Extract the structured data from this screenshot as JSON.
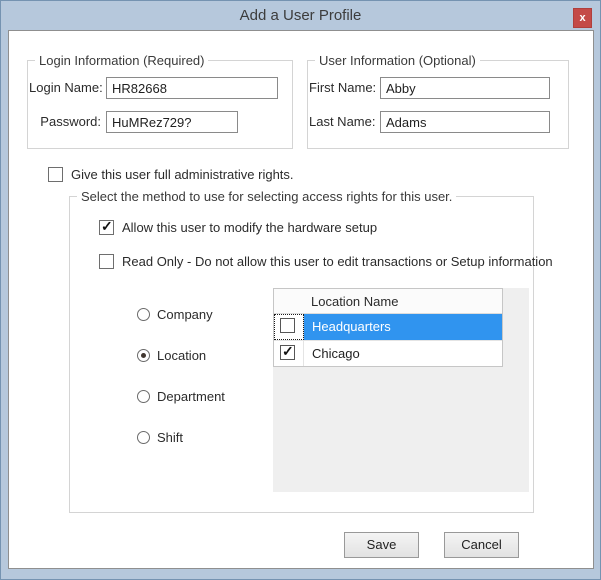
{
  "window": {
    "title": "Add a User Profile",
    "close_label": "x"
  },
  "icons": {
    "checkmark": "✓"
  },
  "colors": {
    "titlebar": "#b6c8dc",
    "close_button": "#c44a47",
    "selection_blue": "#3094ef"
  },
  "login_group": {
    "legend": "Login Information (Required)",
    "login_name": {
      "label": "Login Name:",
      "value": "HR82668"
    },
    "password": {
      "label": "Password:",
      "value": "HuMRez729?"
    }
  },
  "user_group": {
    "legend": "User Information (Optional)",
    "first_name": {
      "label": "First Name:",
      "value": "Abby"
    },
    "last_name": {
      "label": "Last Name:",
      "value": "Adams"
    }
  },
  "admin_checkbox": {
    "label": "Give this user full administrative rights.",
    "checked": false
  },
  "access_group": {
    "legend": "Select the method to use for selecting access rights for this user.",
    "hardware_checkbox": {
      "label": "Allow this user to modify the hardware setup",
      "checked": true
    },
    "readonly_checkbox": {
      "label": "Read Only - Do not allow this user to edit transactions or Setup information",
      "checked": false
    },
    "radios": [
      {
        "label": "Company",
        "selected": false
      },
      {
        "label": "Location",
        "selected": true
      },
      {
        "label": "Department",
        "selected": false
      },
      {
        "label": "Shift",
        "selected": false
      }
    ],
    "location_list": {
      "header": "Location Name",
      "rows": [
        {
          "name": "Headquarters",
          "checked": false,
          "selected": true
        },
        {
          "name": "Chicago",
          "checked": true,
          "selected": false
        }
      ]
    }
  },
  "buttons": {
    "save": "Save",
    "cancel": "Cancel"
  }
}
